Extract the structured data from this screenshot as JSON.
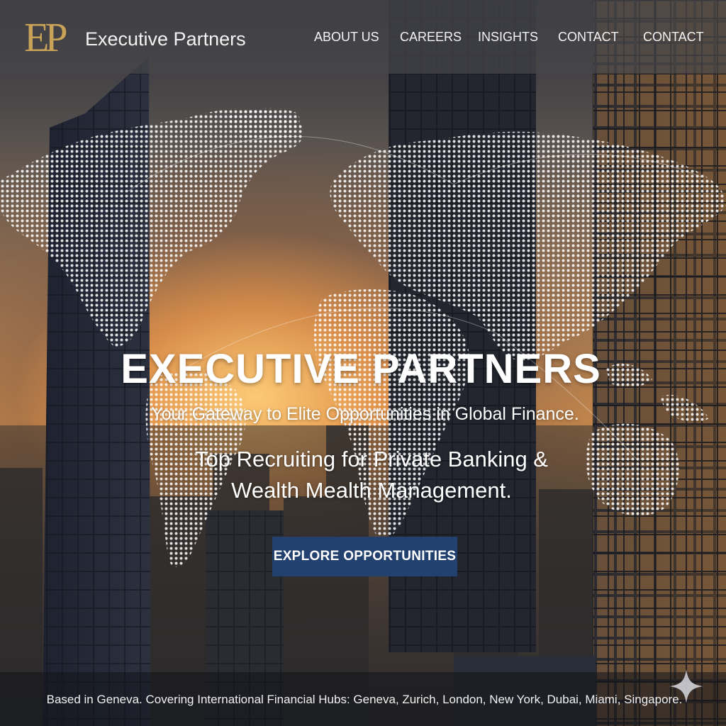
{
  "header": {
    "logo_mark": "EP",
    "brand_name": "Executive Partners",
    "nav": [
      {
        "label": "ABOUT US"
      },
      {
        "label": "CAREERS"
      },
      {
        "label": "INSIGHTS"
      },
      {
        "label": "CONTACT"
      },
      {
        "label": "CONTACT"
      }
    ]
  },
  "hero": {
    "title": "EXECUTIVE PARTNERS",
    "subtitle": "Your Gateway to Elite Opportunities in Global Finance.",
    "tagline_line1": "Top Recruiting for Private Banking &",
    "tagline_line2": "Wealth Mealth Management.",
    "cta_label": "EXPLORE OPPORTUNITIES"
  },
  "footer": {
    "text": "Based in Geneva. Covering International Financial Hubs: Geneva, Zurich, London, New York, Dubai, Miami, Singapore."
  },
  "icons": {
    "logo": "ep-monogram-logo",
    "corner": "sparkle-icon"
  },
  "colors": {
    "accent_gold": "#c7a257",
    "cta_blue": "#23416f",
    "header_bg": "#46464a"
  }
}
